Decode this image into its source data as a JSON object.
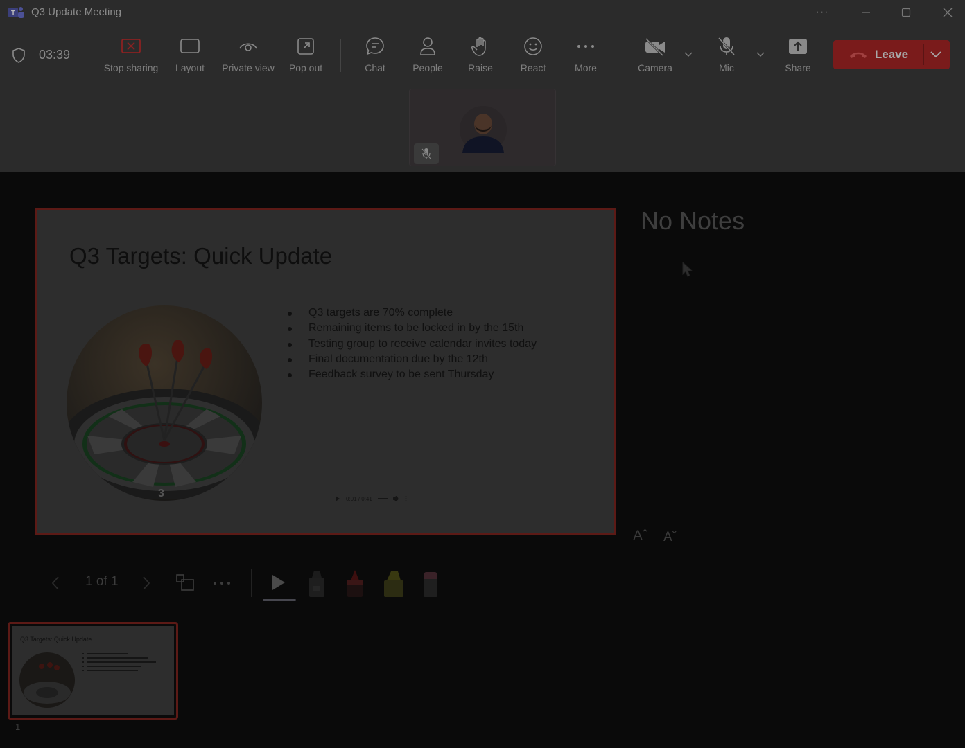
{
  "window": {
    "title": "Q3 Update Meeting",
    "more_glyph": "···"
  },
  "toolbar": {
    "timer": "03:39",
    "buttons": {
      "stop_sharing": "Stop sharing",
      "layout": "Layout",
      "private_view": "Private view",
      "pop_out": "Pop out",
      "chat": "Chat",
      "people": "People",
      "raise": "Raise",
      "react": "React",
      "more": "More",
      "camera": "Camera",
      "mic": "Mic",
      "share": "Share"
    },
    "leave_label": "Leave"
  },
  "colors": {
    "leave": "#7a1b1b",
    "selection_border": "#5c1a16",
    "stop_sharing_accent": "#8b2222"
  },
  "slide": {
    "title": "Q3 Targets: Quick Update",
    "bullets": [
      "Q3 targets are 70% complete",
      "Remaining items to be locked in by the 15th",
      "Testing group to receive calendar invites today",
      "Final documentation due by the 12th",
      "Feedback survey to be sent Thursday"
    ],
    "media_time": "0:01 / 0:41",
    "dartboard_number": "3"
  },
  "notes": {
    "text": "No Notes"
  },
  "font_controls": {
    "increase": "Aˆ",
    "decrease": "Aˇ"
  },
  "navigation": {
    "page": "1 of 1"
  },
  "thumbnails": [
    {
      "number": "1",
      "title": "Q3 Targets: Quick Update"
    }
  ],
  "icons": {
    "stop_sharing": "stop-sharing-icon",
    "layout": "layout-icon",
    "private_view": "eye-icon",
    "pop_out": "pop-out-icon",
    "chat": "chat-icon",
    "people": "people-icon",
    "raise": "hand-icon",
    "react": "smiley-icon",
    "more": "ellipsis-icon",
    "camera": "camera-off-icon",
    "mic": "mic-off-icon",
    "share": "share-tray-icon"
  }
}
